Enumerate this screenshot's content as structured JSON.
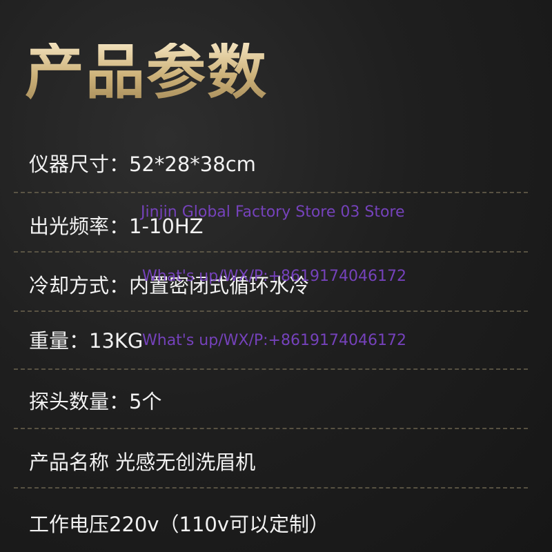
{
  "title": "产品参数",
  "specs": [
    "仪器尺寸：52*28*38cm",
    "出光频率：1-10HZ",
    "冷却方式：内置密闭式循环水冷",
    "重量：13KG",
    "探头数量：5个",
    "产品名称 光感无创洗眉机",
    "工作电压220v（110v可以定制）"
  ],
  "watermarks": {
    "store": "Jinjin Global Factory Store 03 Store",
    "contact_1": "What's up/WX/P:+8619174046172",
    "contact_2": "What's up/WX/P:+8619174046172"
  },
  "colors": {
    "background": "#1f1f1f",
    "title_gold": "#d6c39a",
    "text": "#f2f2f2",
    "divider": "#6d6550",
    "watermark": "#7d45c9"
  }
}
